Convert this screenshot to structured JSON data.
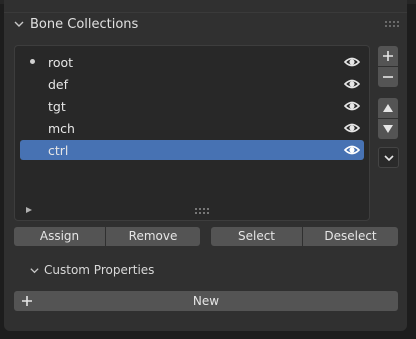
{
  "panel": {
    "title": "Bone Collections"
  },
  "collections": [
    {
      "name": "root",
      "active": true,
      "visible": true
    },
    {
      "name": "def",
      "active": false,
      "visible": true
    },
    {
      "name": "tgt",
      "active": false,
      "visible": true
    },
    {
      "name": "mch",
      "active": false,
      "visible": true
    },
    {
      "name": "ctrl",
      "selected": true,
      "visible": true
    }
  ],
  "side_buttons": {
    "add": "plus-icon",
    "remove": "minus-icon",
    "move_up": "triangle-up-icon",
    "move_down": "triangle-down-icon",
    "specials": "chevron-down-icon"
  },
  "actions": {
    "assign": "Assign",
    "remove": "Remove",
    "select": "Select",
    "deselect": "Deselect"
  },
  "custom_properties": {
    "title": "Custom Properties",
    "new_label": "New"
  },
  "colors": {
    "selected_row": "#4772b3",
    "panel": "#303030",
    "button": "#545454",
    "list_bg": "#282828"
  }
}
